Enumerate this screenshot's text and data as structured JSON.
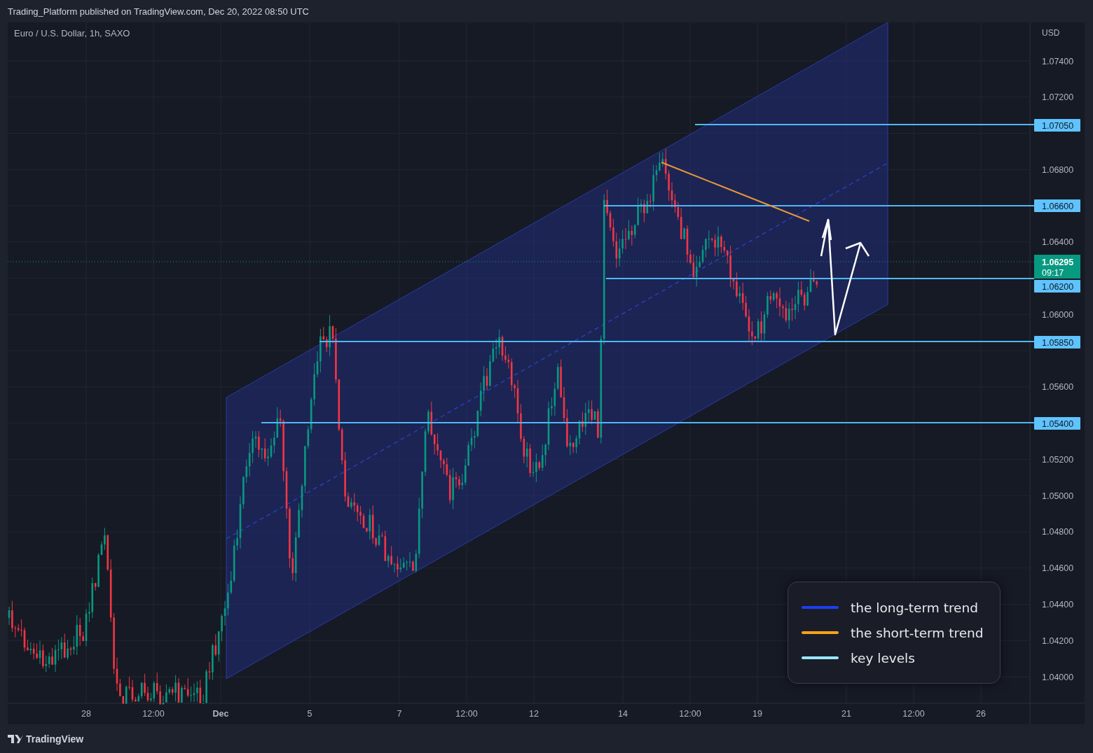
{
  "header": {
    "title": "Trading_Platform published on TradingView.com, Dec 20, 2022 08:50 UTC"
  },
  "chart": {
    "symbol": "Euro / U.S. Dollar, 1h, SAXO",
    "currency": "USD",
    "price_ticks": [
      "1.07400",
      "1.07200",
      "1.06800",
      "1.06400",
      "1.06000",
      "1.05600",
      "1.05200",
      "1.05000",
      "1.04800",
      "1.04600",
      "1.04400",
      "1.04200",
      "1.04000"
    ],
    "key_levels": [
      "1.07050",
      "1.06600",
      "1.06200",
      "1.05850",
      "1.05400"
    ],
    "last_price": {
      "price": "1.06295",
      "countdown": "09:17"
    },
    "time_labels": [
      "28",
      "12:00",
      "Dec",
      "5",
      "7",
      "12:00",
      "12",
      "14",
      "12:00",
      "19",
      "21",
      "12:00",
      "26"
    ]
  },
  "legend": [
    {
      "label": "the long-term trend",
      "color": "#1e3df5"
    },
    {
      "label": "the short-term trend",
      "color": "#f7a21b"
    },
    {
      "label": "key levels",
      "color": "#9be6ff"
    }
  ],
  "footer": {
    "brand": "TradingView"
  }
}
